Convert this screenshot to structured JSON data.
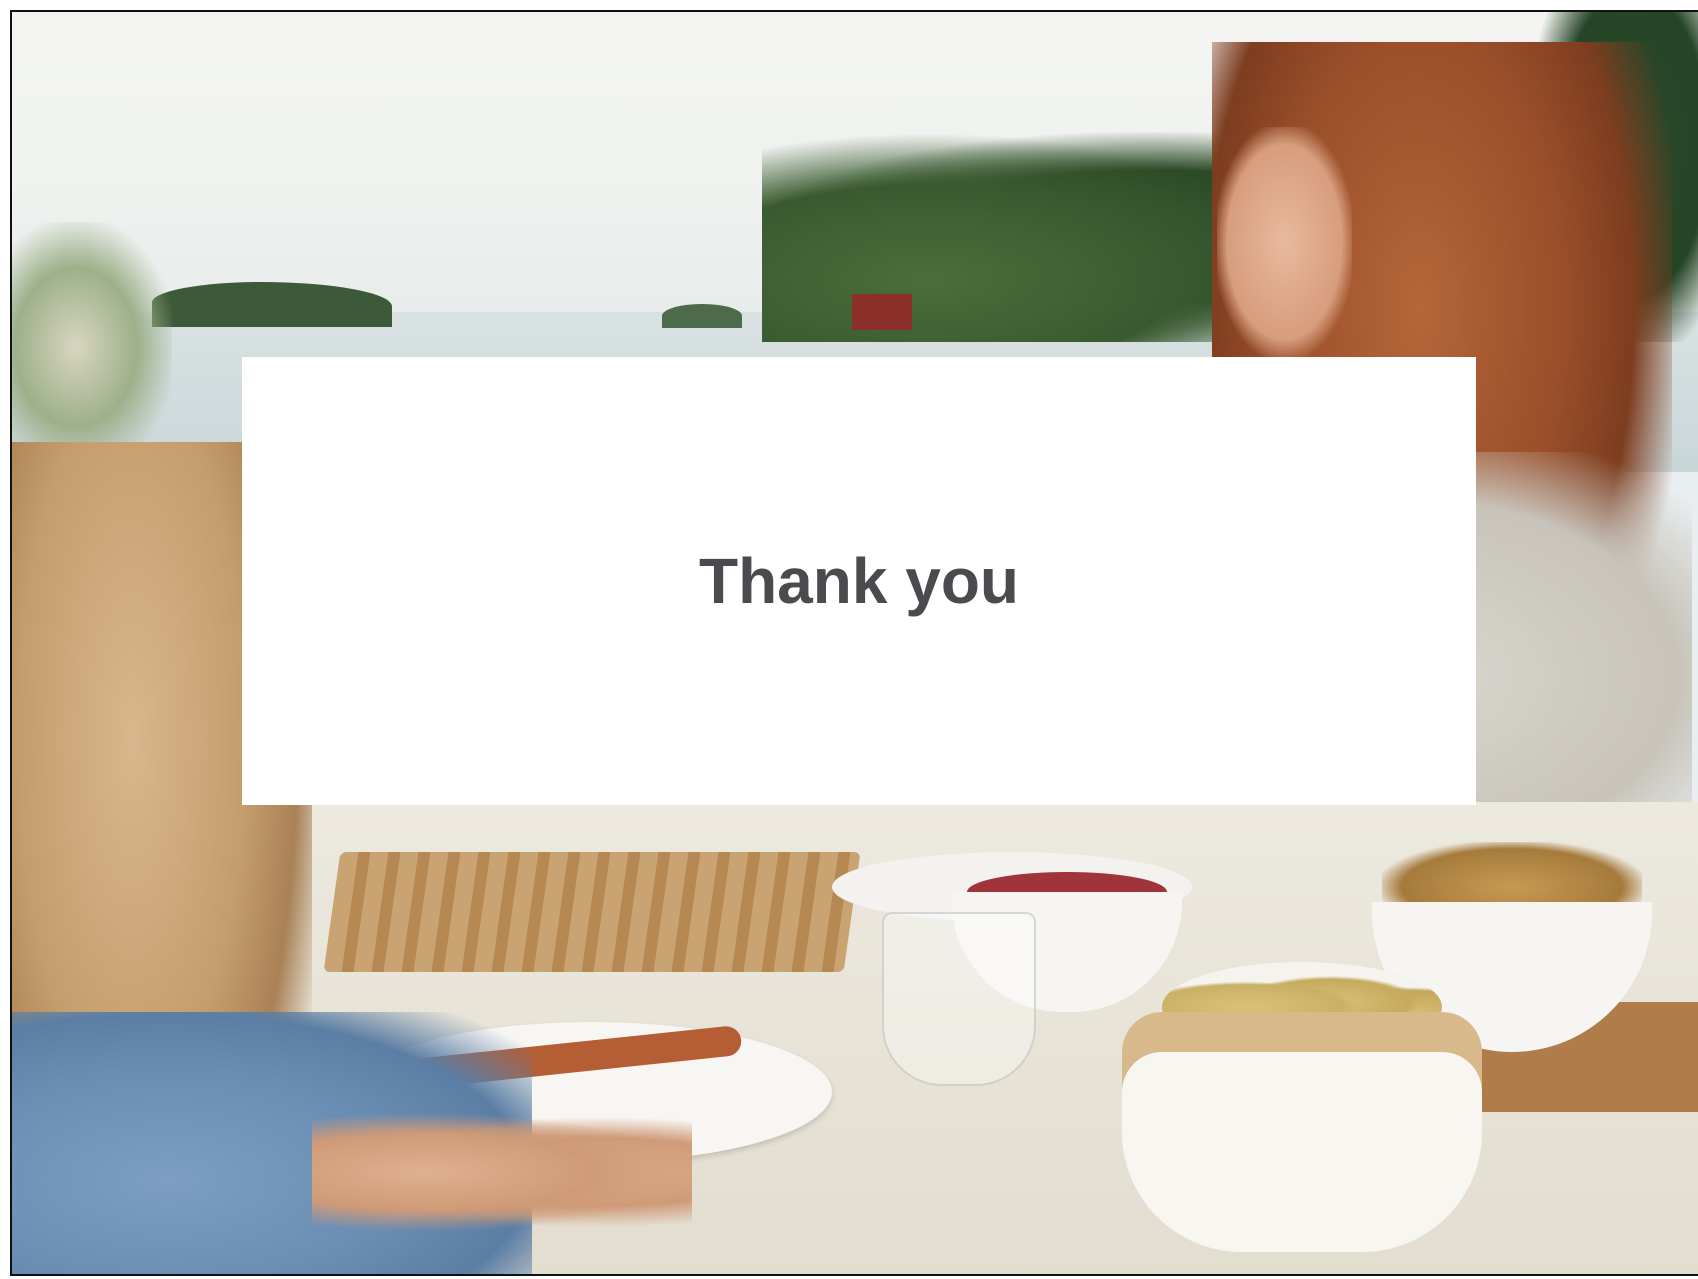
{
  "slide": {
    "title": "Thank you",
    "background_description_icon": "photo-outdoor-lakeside-meal"
  },
  "colors": {
    "title_text": "#4b4b4f",
    "title_box": "#ffffff",
    "frame_border": "#111111"
  }
}
